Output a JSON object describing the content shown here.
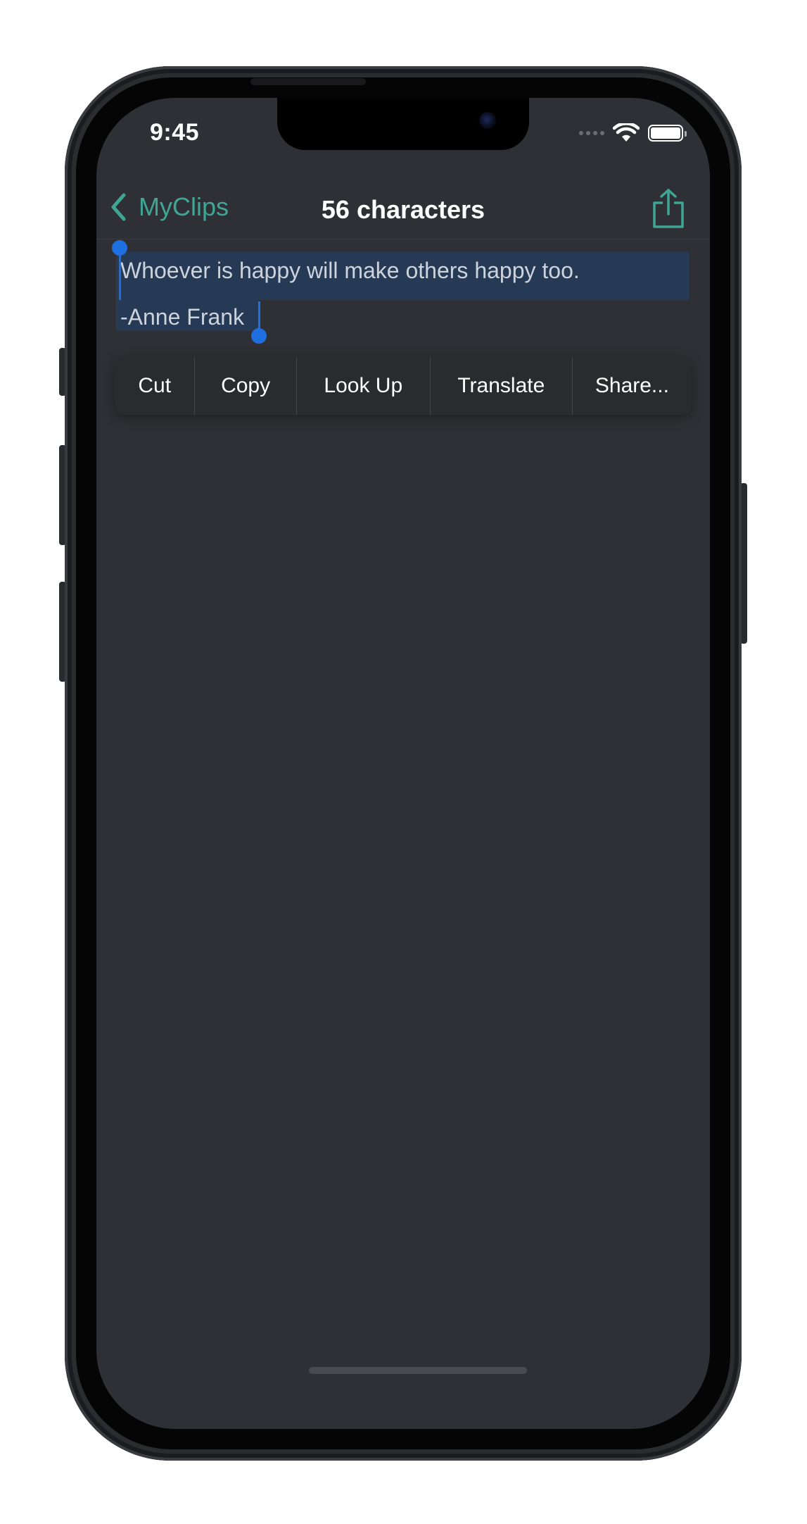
{
  "status_bar": {
    "time": "9:45",
    "wifi_icon": "wifi-icon",
    "battery_icon": "battery-full-icon"
  },
  "nav": {
    "back_label": "MyClips",
    "back_icon": "chevron-left-icon",
    "title": "56 characters",
    "share_icon": "share-icon",
    "accent_color": "#3fa696"
  },
  "editor": {
    "line1": "Whoever is happy will make others happy too.",
    "line2": "-Anne Frank",
    "selection_color": "#263a56",
    "handle_color": "#1e6fe0"
  },
  "context_menu": {
    "items": [
      {
        "label": "Cut"
      },
      {
        "label": "Copy"
      },
      {
        "label": "Look Up"
      },
      {
        "label": "Translate"
      },
      {
        "label": "Share..."
      }
    ]
  }
}
